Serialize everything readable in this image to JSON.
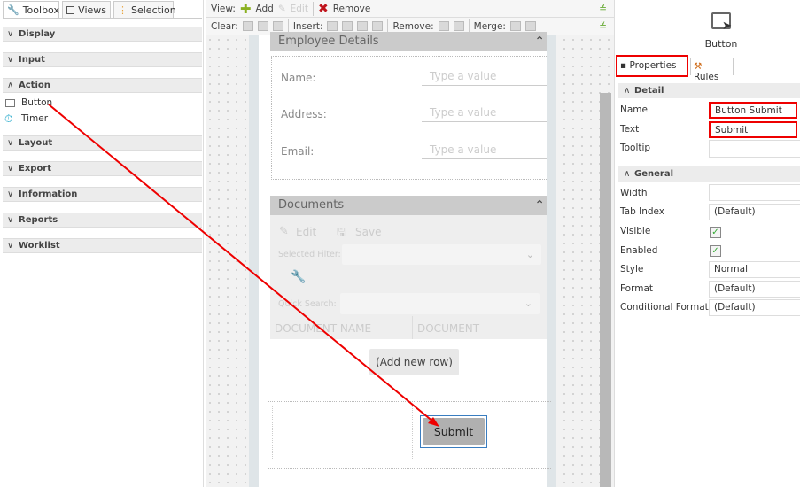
{
  "toolbox": {
    "tabs": [
      {
        "label": "Toolbox",
        "icon": "wrench-icon"
      },
      {
        "label": "Views",
        "icon": "views-icon"
      },
      {
        "label": "Selection",
        "icon": "tree-icon"
      }
    ],
    "sections": [
      {
        "label": "Display",
        "expanded": false
      },
      {
        "label": "Input",
        "expanded": false
      },
      {
        "label": "Action",
        "expanded": true,
        "items": [
          {
            "label": "Button",
            "icon": "button-cursor-icon"
          },
          {
            "label": "Timer",
            "icon": "timer-icon"
          }
        ]
      },
      {
        "label": "Layout",
        "expanded": false
      },
      {
        "label": "Export",
        "expanded": false
      },
      {
        "label": "Information",
        "expanded": false
      },
      {
        "label": "Reports",
        "expanded": false
      },
      {
        "label": "Worklist",
        "expanded": false
      }
    ]
  },
  "toolbar": {
    "view_label": "View:",
    "add": "Add",
    "edit": "Edit",
    "remove": "Remove",
    "clear_label": "Clear:",
    "insert_label": "Insert:",
    "remove_label": "Remove:",
    "merge_label": "Merge:"
  },
  "form": {
    "employee": {
      "title": "Employee Details",
      "fields": [
        {
          "label": "Name:",
          "placeholder": "Type a value"
        },
        {
          "label": "Address:",
          "placeholder": "Type a value"
        },
        {
          "label": "Email:",
          "placeholder": "Type a value"
        }
      ]
    },
    "documents": {
      "title": "Documents",
      "edit": "Edit",
      "save": "Save",
      "selected_filter": "Selected Filter:",
      "quick_search": "Quick Search:",
      "columns": [
        "DOCUMENT NAME",
        "DOCUMENT"
      ],
      "add_row": "(Add new row)"
    },
    "submit": "Submit"
  },
  "properties": {
    "control_type": "Button",
    "tabs": [
      "Properties",
      "Rules"
    ],
    "detail_header": "Detail",
    "general_header": "General",
    "detail": [
      {
        "label": "Name",
        "value": "Button Submit"
      },
      {
        "label": "Text",
        "value": "Submit"
      },
      {
        "label": "Tooltip",
        "value": ""
      }
    ],
    "general": [
      {
        "label": "Width",
        "value": ""
      },
      {
        "label": "Tab Index",
        "value": "(Default)"
      },
      {
        "label": "Visible",
        "checked": true
      },
      {
        "label": "Enabled",
        "checked": true
      },
      {
        "label": "Style",
        "value": "Normal"
      },
      {
        "label": "Format",
        "value": "(Default)"
      },
      {
        "label": "Conditional Format",
        "value": "(Default)"
      }
    ]
  },
  "colors": {
    "highlight": "#e00000",
    "add": "#8ab020",
    "remove": "#c0141c"
  }
}
